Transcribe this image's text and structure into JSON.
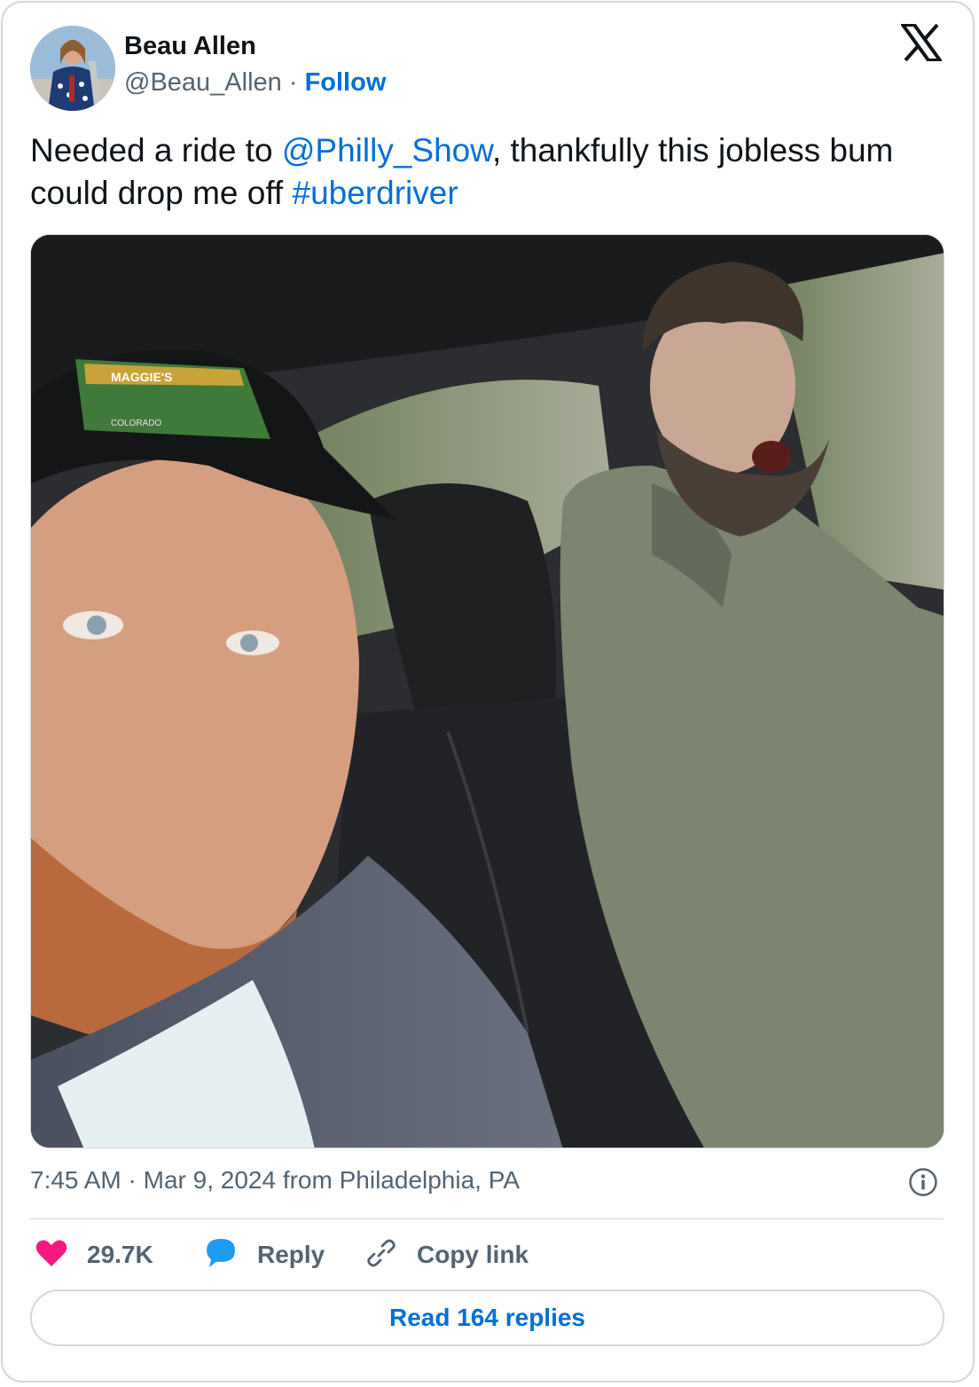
{
  "author": {
    "display_name": "Beau Allen",
    "handle": "@Beau_Allen",
    "separator": " · ",
    "follow_label": "Follow"
  },
  "tweet": {
    "text_part1": "Needed a ride to ",
    "mention": "@Philly_Show",
    "text_part2": ", thankfully this jobless bum could drop me off ",
    "hashtag": "#uberdriver"
  },
  "photo": {
    "alt_icon": "photo-image",
    "hat_patch_text": "MAGGIE'S",
    "hat_patch_subtext": "COLORADO"
  },
  "meta": {
    "time": "7:45 AM",
    "separator": " · ",
    "date": "Mar 9, 2024",
    "location": " from Philadelphia, PA"
  },
  "actions": {
    "likes_count": "29.7K",
    "reply_label": "Reply",
    "copy_link_label": "Copy link"
  },
  "read_replies_label": "Read 164 replies",
  "colors": {
    "link": "#006fd6",
    "secondary_text": "#536471",
    "heart": "#f91880",
    "reply_bubble": "#1d9bf0",
    "border": "#cfd9de"
  },
  "icons": {
    "platform_logo": "x-logo-icon",
    "info": "info-icon",
    "like": "heart-icon",
    "reply": "speech-bubble-icon",
    "copy": "link-icon"
  }
}
